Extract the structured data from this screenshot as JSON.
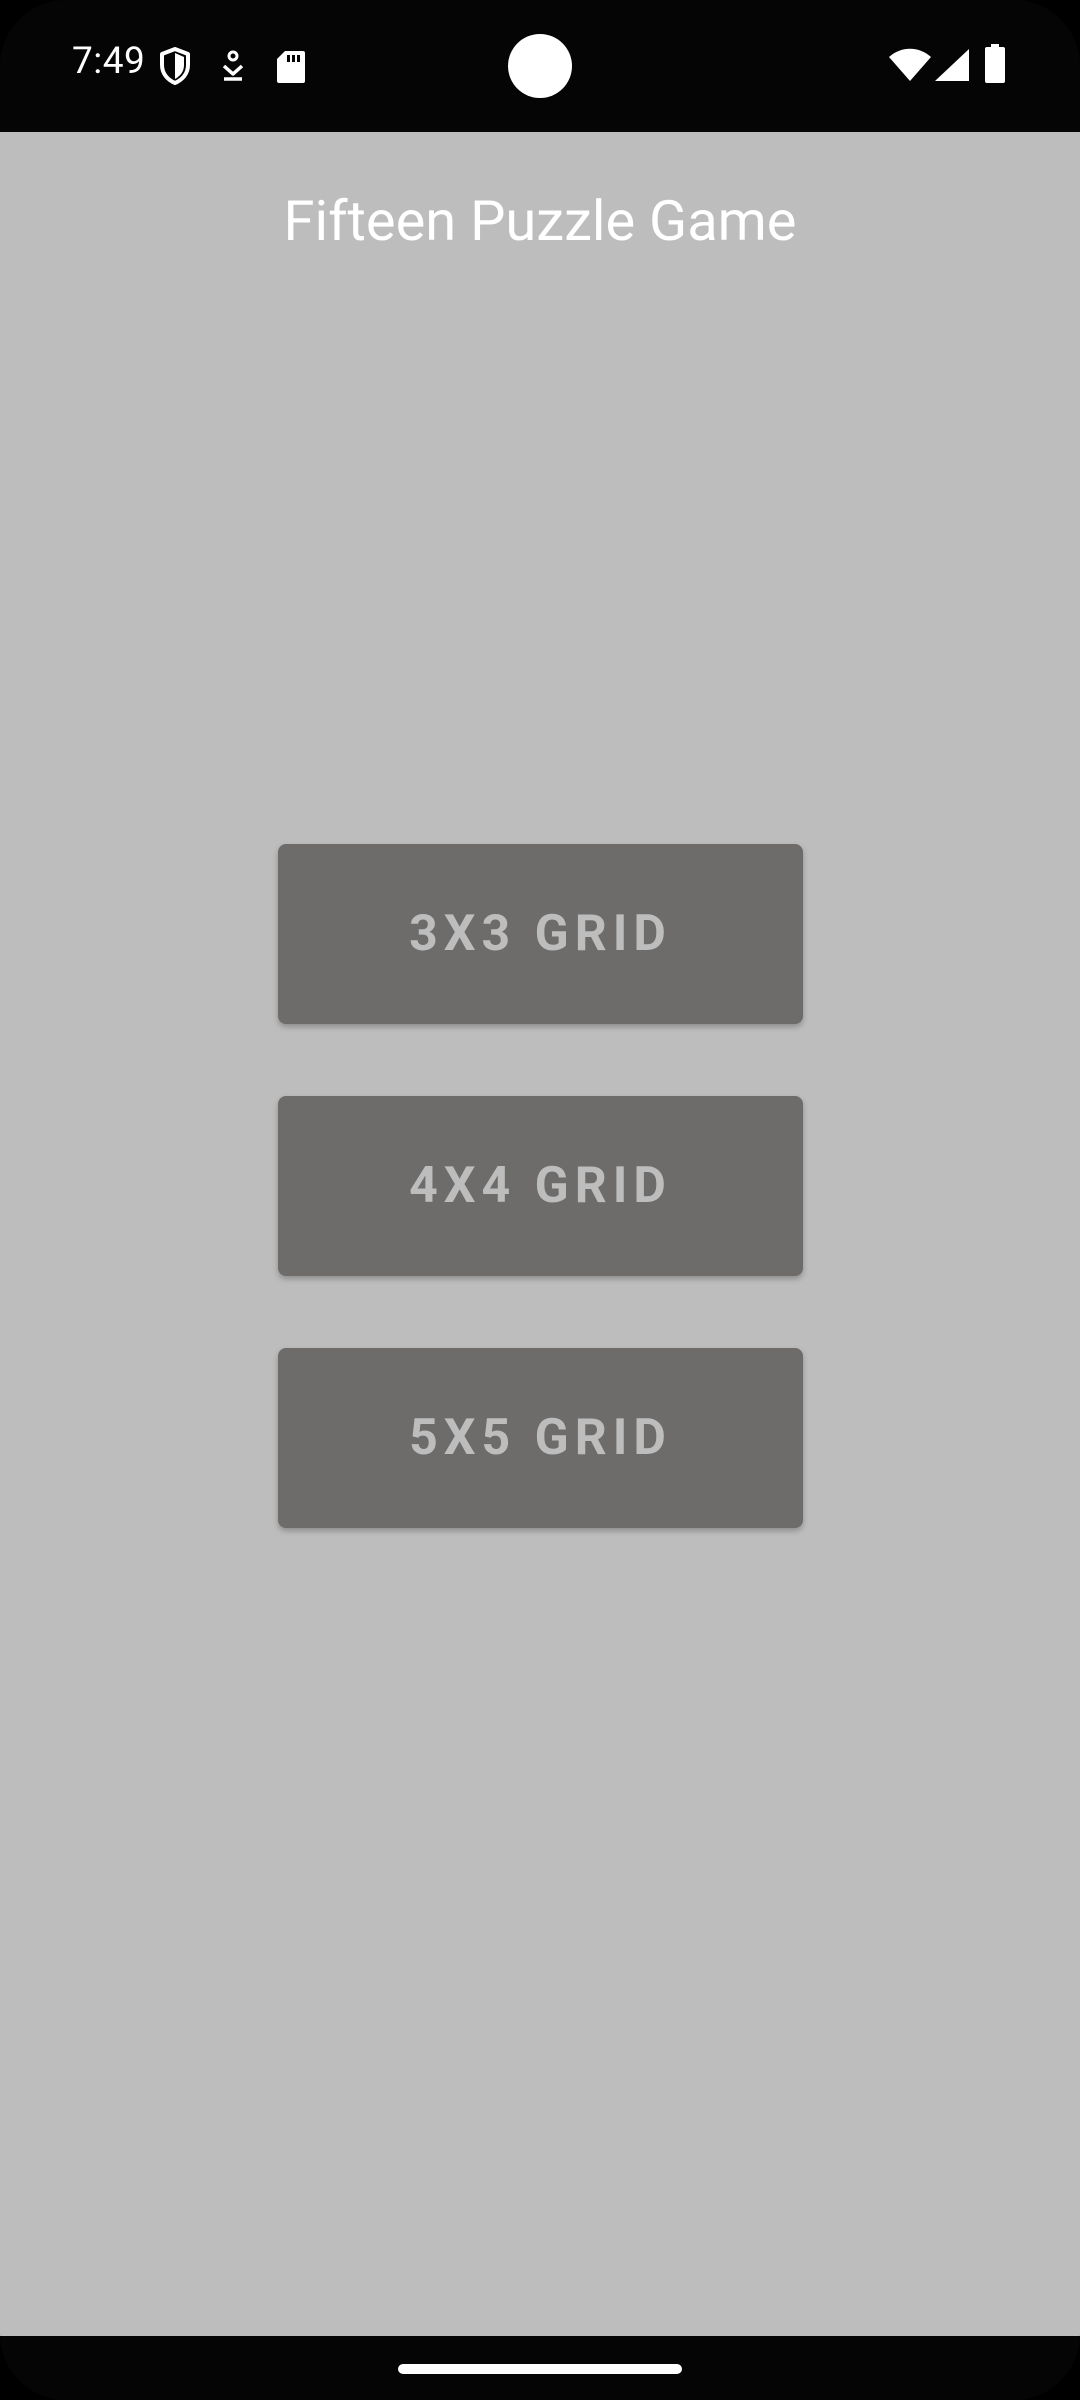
{
  "status_bar": {
    "time": "7:49",
    "left_icons": [
      "shield-icon",
      "download-icon",
      "sd-card-icon"
    ],
    "right_icons": [
      "wifi-icon",
      "signal-icon",
      "battery-icon"
    ]
  },
  "app": {
    "title": "Fifteen Puzzle Game",
    "background_color": "#bdbdbd",
    "button_color": "#6d6c6b",
    "button_text_color": "#bdbdbd"
  },
  "buttons": [
    {
      "label": "3X3 GRID"
    },
    {
      "label": "4X4 GRID"
    },
    {
      "label": "5X5 GRID"
    }
  ]
}
